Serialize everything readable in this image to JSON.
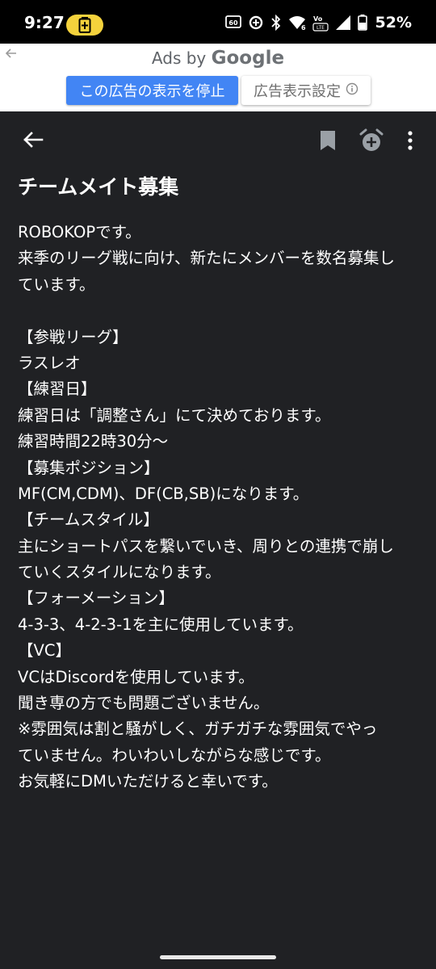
{
  "status_bar": {
    "time": "9:27",
    "battery_percent": "52%",
    "icons": [
      "battery-saver-icon",
      "hd-call-icon",
      "data-saver-icon",
      "bluetooth-icon",
      "wifi-icon",
      "volte-icon",
      "signal-icon",
      "battery-icon"
    ]
  },
  "ad": {
    "ads_by": "Ads by",
    "google": "Google",
    "stop_label": "この広告の表示を停止",
    "settings_label": "広告表示設定",
    "stop_color": "#4285f4"
  },
  "app_bar": {
    "icons": [
      "back-arrow-icon",
      "bookmark-icon",
      "add-alarm-icon",
      "more-vert-icon"
    ]
  },
  "post": {
    "title": "チームメイト募集",
    "lines": [
      "ROBOKOPです。",
      "来季のリーグ戦に向け、新たにメンバーを数名募集し",
      "ています。",
      "",
      "【参戦リーグ】",
      "ラスレオ",
      "【練習日】",
      "練習日は「調整さん」にて決めております。",
      "練習時間22時30分〜",
      "【募集ポジション】",
      "MF(CM,CDM)、DF(CB,SB)になります。",
      "【チームスタイル】",
      "主にショートパスを繋いでいき、周りとの連携で崩し",
      "ていくスタイルになります。",
      "【フォーメーション】",
      "4-3-3、4-2-3-1を主に使用しています。",
      "【VC】",
      "VCはDiscordを使用しています。",
      "聞き専の方でも問題ございません。",
      "※雰囲気は割と騒がしく、ガチガチな雰囲気でやっ",
      "ていません。わいわいしながらな感じです。",
      "お気軽にDMいただけると幸いです。"
    ]
  },
  "colors": {
    "background": "#202124",
    "status_bar": "#000000",
    "battery_saver": "#f4d23c",
    "text": "#ffffff",
    "icon": "#9aa0a6"
  }
}
